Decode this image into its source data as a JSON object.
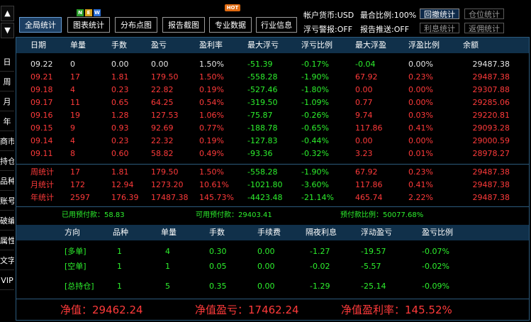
{
  "side_nav": {
    "up_arrow": "▲",
    "down_arrow": "▼",
    "items": [
      "日",
      "周",
      "月",
      "年",
      "商市",
      "持仓",
      "品种",
      "账号",
      "破编",
      "属性",
      "文字",
      "VIP"
    ]
  },
  "toolbar": {
    "buttons": [
      "全局统计",
      "图表统计",
      "分布点图",
      "报告截图",
      "专业数据",
      "行业信息"
    ],
    "new_badge": [
      "N",
      "E",
      "W"
    ],
    "hot_badge": "HOT",
    "account_currency": "帐户货币:USD",
    "max_ratio": "最合比例:100%",
    "float_loss_alert": "浮亏警报:OFF",
    "report_push": "报告推送:OFF",
    "right_buttons": [
      "回撤统计",
      "仓位统计",
      "利息统计",
      "返佣统计"
    ]
  },
  "stats_table": {
    "headers": [
      "日期",
      "单量",
      "手数",
      "盈亏",
      "盈利率",
      "最大浮亏",
      "浮亏比例",
      "最大浮盈",
      "浮盈比例",
      "余额"
    ],
    "rows": [
      [
        "09.22",
        "0",
        "0.00",
        "0.00",
        "1.50%",
        "-51.39",
        "-0.17%",
        "-0.04",
        "0.00%",
        "29487.38"
      ],
      [
        "09.21",
        "17",
        "1.81",
        "179.50",
        "1.50%",
        "-558.28",
        "-1.90%",
        "67.92",
        "0.23%",
        "29487.38"
      ],
      [
        "09.18",
        "4",
        "0.23",
        "22.82",
        "0.19%",
        "-527.46",
        "-1.80%",
        "0.00",
        "0.00%",
        "29307.88"
      ],
      [
        "09.17",
        "11",
        "0.65",
        "64.25",
        "0.54%",
        "-319.50",
        "-1.09%",
        "0.77",
        "0.00%",
        "29285.06"
      ],
      [
        "09.16",
        "19",
        "1.28",
        "127.53",
        "1.06%",
        "-75.87",
        "-0.26%",
        "9.74",
        "0.03%",
        "29220.81"
      ],
      [
        "09.15",
        "9",
        "0.93",
        "92.69",
        "0.77%",
        "-188.78",
        "-0.65%",
        "117.86",
        "0.41%",
        "29093.28"
      ],
      [
        "09.14",
        "4",
        "0.23",
        "22.32",
        "0.19%",
        "-127.83",
        "-0.44%",
        "0.00",
        "0.00%",
        "29000.59"
      ],
      [
        "09.11",
        "8",
        "0.60",
        "58.82",
        "0.49%",
        "-93.36",
        "-0.32%",
        "3.23",
        "0.01%",
        "28978.27"
      ]
    ],
    "summary_rows": [
      [
        "周统计",
        "17",
        "1.81",
        "179.50",
        "1.50%",
        "-558.28",
        "-1.90%",
        "67.92",
        "0.23%",
        "29487.38"
      ],
      [
        "月统计",
        "172",
        "12.94",
        "1273.20",
        "10.61%",
        "-1021.80",
        "-3.60%",
        "117.86",
        "0.41%",
        "29487.38"
      ],
      [
        "年统计",
        "2597",
        "176.39",
        "17487.38",
        "145.73%",
        "-4423.48",
        "-21.14%",
        "465.74",
        "2.22%",
        "29487.38"
      ]
    ]
  },
  "margin": {
    "used": "已用预付款：58.83",
    "available": "可用预付款：29403.41",
    "ratio": "预付款比例：50077.68%"
  },
  "positions": {
    "headers": [
      "方向",
      "品种",
      "单量",
      "手数",
      "手续费",
      "隔夜利息",
      "浮动盈亏",
      "盈亏比例"
    ],
    "rows": [
      [
        "[多单]",
        "1",
        "4",
        "0.30",
        "0.00",
        "-1.27",
        "-19.57",
        "-0.07%"
      ],
      [
        "[空单]",
        "1",
        "1",
        "0.05",
        "0.00",
        "-0.02",
        "-5.57",
        "-0.02%"
      ],
      [
        "[总持仓]",
        "1",
        "5",
        "0.35",
        "0.00",
        "-1.29",
        "-25.14",
        "-0.09%"
      ]
    ]
  },
  "equity": {
    "net_value": "净值：29462.24",
    "net_profit": "净值盈亏：17462.24",
    "net_profit_rate": "净值盈利率：145.52%"
  },
  "colors": {
    "accent": "#1d3f63",
    "header_bg": "#10304a",
    "profit": "#ff3a3a",
    "loss": "#2df02d",
    "neutral": "#e6e6e6"
  }
}
